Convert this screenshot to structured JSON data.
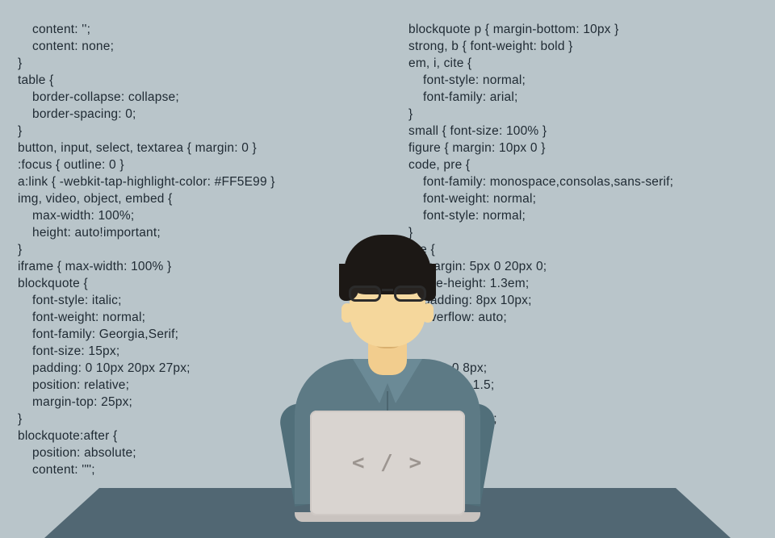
{
  "code": {
    "left": "    content: '';\n    content: none;\n}\ntable {\n    border-collapse: collapse;\n    border-spacing: 0;\n}\nbutton, input, select, textarea { margin: 0 }\n:focus { outline: 0 }\na:link { -webkit-tap-highlight-color: #FF5E99 }\nimg, video, object, embed {\n    max-width: 100%;\n    height: auto!important;\n}\niframe { max-width: 100% }\nblockquote {\n    font-style: italic;\n    font-weight: normal;\n    font-family: Georgia,Serif;\n    font-size: 15px;\n    padding: 0 10px 20px 27px;\n    position: relative;\n    margin-top: 25px;\n}\nblockquote:after {\n    position: absolute;\n    content: '\"';",
    "right": "blockquote p { margin-bottom: 10px }\nstrong, b { font-weight: bold }\nem, i, cite {\n    font-style: normal;\n    font-family: arial;\n}\nsmall { font-size: 100% }\nfigure { margin: 10px 0 }\ncode, pre {\n    font-family: monospace,consolas,sans-serif;\n    font-weight: normal;\n    font-style: normal;\n}\npre {\n    margin: 5px 0 20px 0;\n    line-height: 1.3em;\n    padding: 8px 10px;\n    overflow: auto;\n}\n\n        g: 0 8px;\n        eight: 1.5;\n\n         : 1px 6px;\n          0 2px;\n       ack:"
  },
  "laptop": {
    "logo": "< / >"
  }
}
